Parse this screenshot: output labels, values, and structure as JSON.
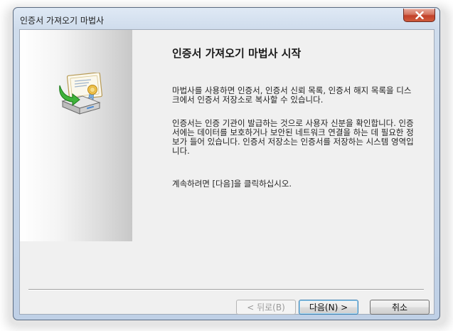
{
  "window": {
    "title": "인증서 가져오기 마법사"
  },
  "wizard": {
    "heading": "인증서 가져오기 마법사 시작",
    "paragraph1": "마법사를 사용하면 인증서, 인증서 신뢰 목록, 인증서 해지 목록을 디스크에서 인증서 저장소로 복사할 수 있습니다.",
    "paragraph2": "인증서는 인증 기관이 발급하는 것으로 사용자 신분을 확인합니다. 인증서에는 데이터를 보호하거나 보안된 네트워크 연결을 하는 데 필요한 정보가 들어 있습니다. 인증서 저장소는 인증서를 저장하는 시스템 영역입니다.",
    "paragraph3": "계속하려면 [다음]을 클릭하십시오."
  },
  "buttons": {
    "back": "< 뒤로(B)",
    "next": "다음(N) >",
    "cancel": "취소"
  },
  "icons": {
    "close": "close-icon",
    "wizard": "certificate-import-icon"
  },
  "colors": {
    "close_button": "#c2412a",
    "client_bg": "#f0f0f0",
    "default_button_border": "#3c7fb1"
  }
}
